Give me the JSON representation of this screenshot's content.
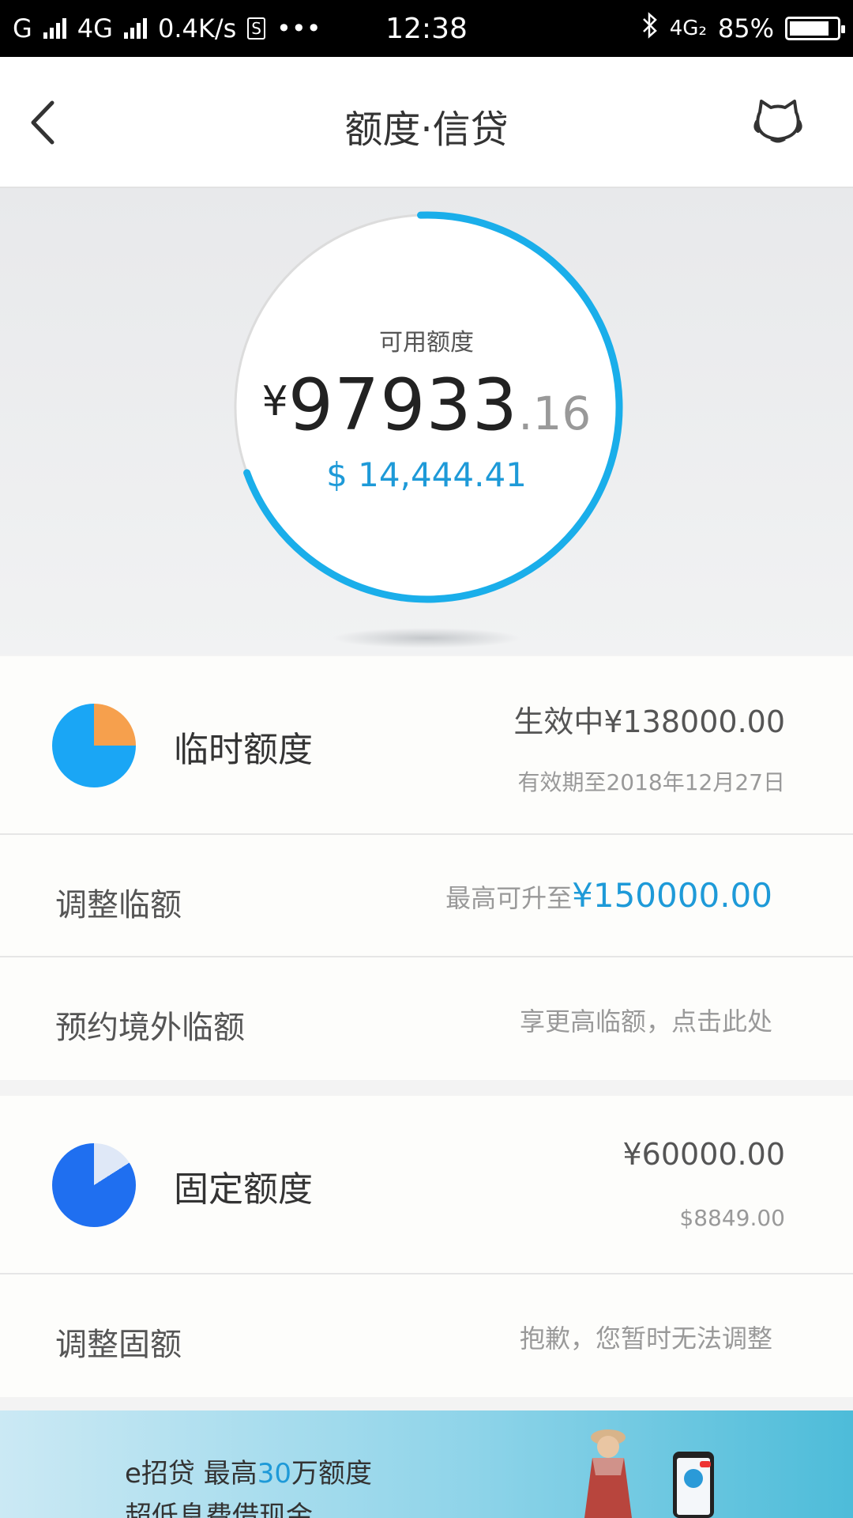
{
  "status_bar": {
    "left_network": "G",
    "network2": "4G",
    "speed": "0.4K/s",
    "app_icon": "S",
    "more": "•••",
    "time": "12:38",
    "right_network": "4G₂",
    "battery": "85%"
  },
  "nav": {
    "title": "额度·信贷"
  },
  "hero": {
    "label": "可用额度",
    "currency": "¥",
    "amount_int": "97933",
    "amount_dec": ".16",
    "usd": "$ 14,444.41",
    "ring_progress": 0.7,
    "ring_color": "#1aaeea"
  },
  "temp_limit": {
    "title": "临时额度",
    "status_amount": "生效中¥138000.00",
    "validity": "有效期至2018年12月27日",
    "pie_colors": [
      "#1aa6f5",
      "#f6a04d"
    ]
  },
  "adjust_temp": {
    "label": "调整临额",
    "hint_prefix": "最高可升至",
    "hint_amount": "¥150000.00"
  },
  "overseas": {
    "label": "预约境外临额",
    "hint": "享更高临额，点击此处"
  },
  "fixed_limit": {
    "title": "固定额度",
    "amount": "¥60000.00",
    "usd": "$8849.00",
    "pie_colors": [
      "#1f6ff0",
      "#dfe8f7"
    ]
  },
  "adjust_fixed": {
    "label": "调整固额",
    "hint": "抱歉，您暂时无法调整"
  },
  "banner": {
    "line1_prefix": "e招贷  最高",
    "line1_num": "30",
    "line1_suffix": "万额度",
    "line2": "超低息费借现金"
  },
  "colors": {
    "accent": "#1e9ad8",
    "ring": "#1aaeea"
  }
}
